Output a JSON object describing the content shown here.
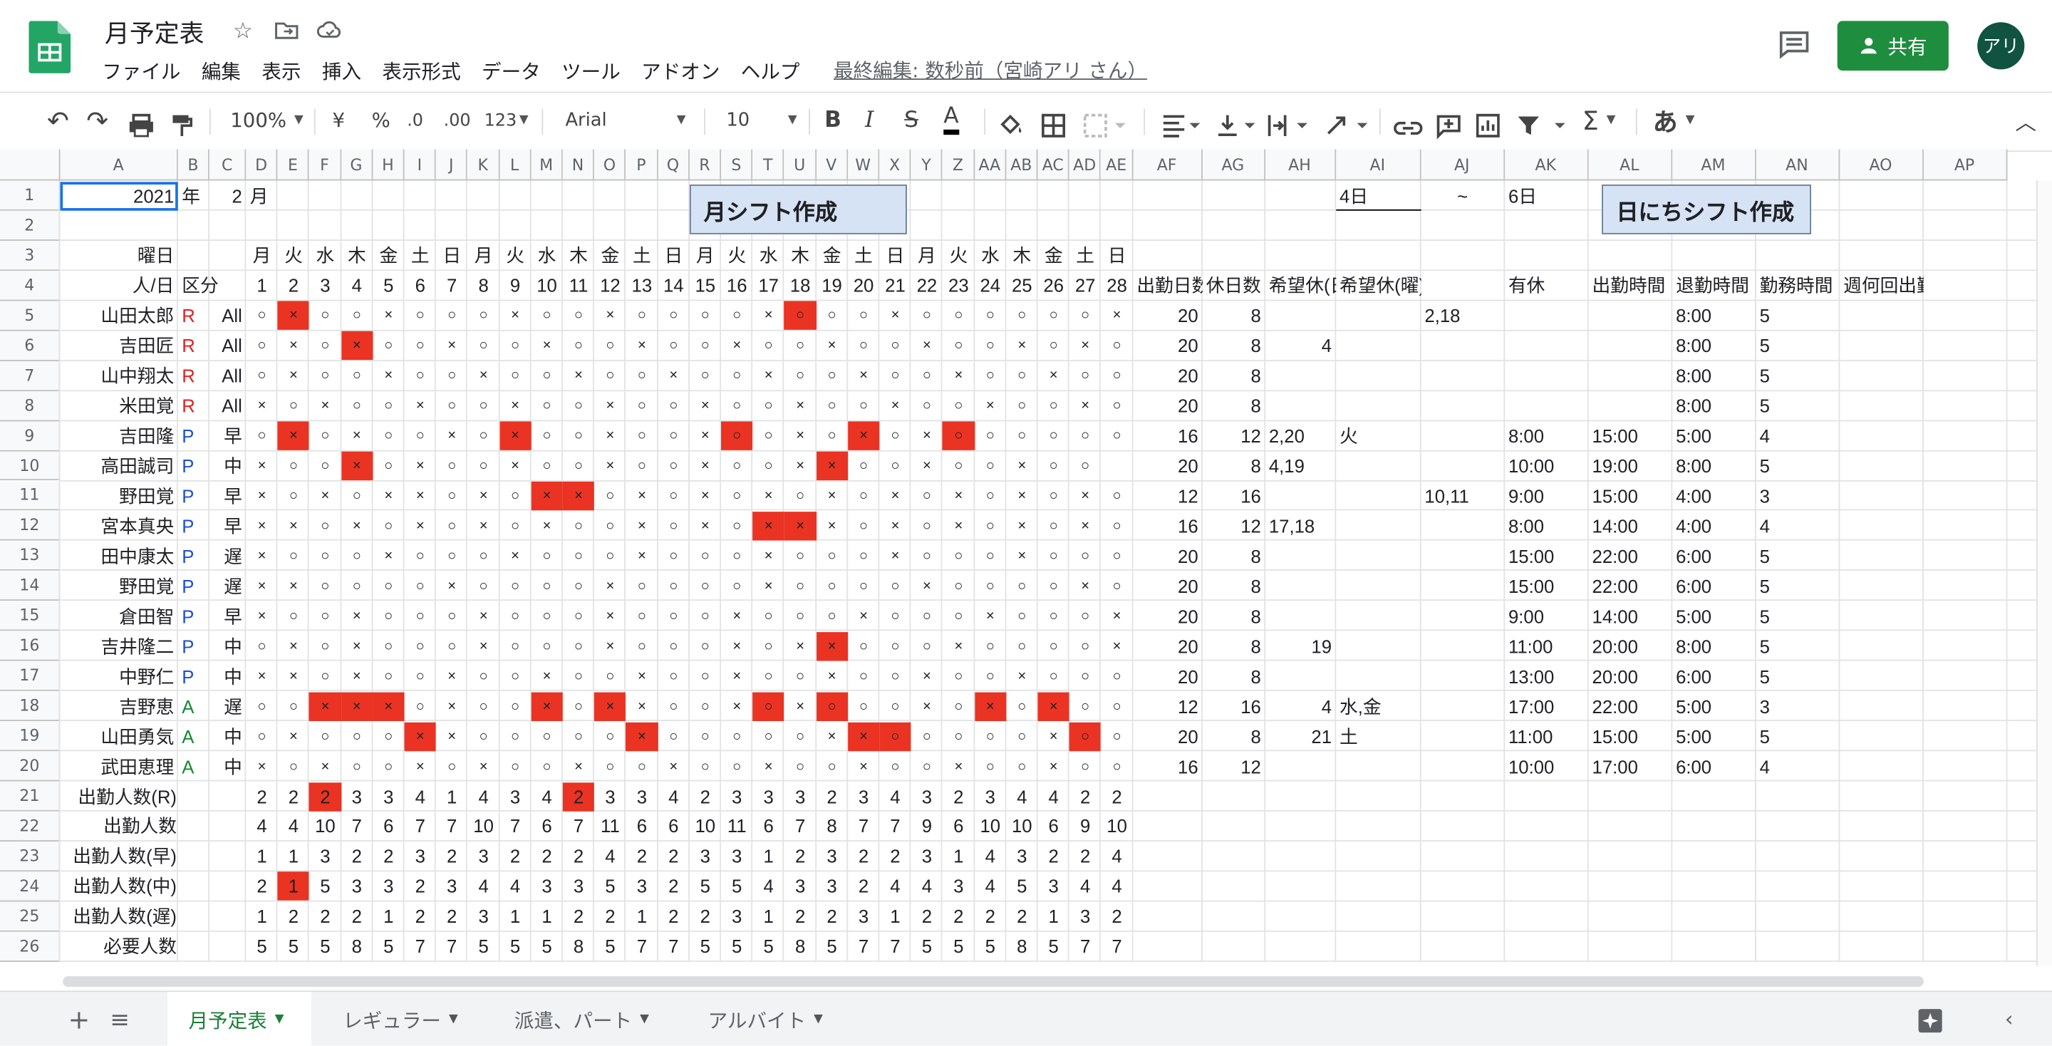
{
  "doc": {
    "title": "月予定表",
    "last_edit": "最終編集: 数秒前（宮崎アリ さん）"
  },
  "menu": [
    "ファイル",
    "編集",
    "表示",
    "挿入",
    "表示形式",
    "データ",
    "ツール",
    "アドオン",
    "ヘルプ"
  ],
  "share_label": "共有",
  "avatar_label": "アリ",
  "toolbar": {
    "zoom": "100%",
    "currency": "¥",
    "percent": "%",
    "dec_decrease": ".0",
    "dec_increase": ".00",
    "format": "123",
    "font": "Arial",
    "size": "10",
    "bold": "B",
    "italic": "I",
    "strike": "S",
    "textcolor": "A",
    "ime": "あ"
  },
  "columns": [
    "A",
    "B",
    "C",
    "D",
    "E",
    "F",
    "G",
    "H",
    "I",
    "J",
    "K",
    "L",
    "M",
    "N",
    "O",
    "P",
    "Q",
    "R",
    "S",
    "T",
    "U",
    "V",
    "W",
    "X",
    "Y",
    "Z",
    "AA",
    "AB",
    "AC",
    "AD",
    "AE",
    "AF",
    "AG",
    "AH",
    "AI",
    "AJ",
    "AK",
    "AL",
    "AM",
    "AN",
    "AO",
    "AP"
  ],
  "rows": [
    "1",
    "2",
    "3",
    "4",
    "5",
    "6",
    "7",
    "8",
    "9",
    "10",
    "11",
    "12",
    "13",
    "14",
    "15",
    "16",
    "17",
    "18",
    "19",
    "20",
    "21",
    "22",
    "23",
    "24",
    "25",
    "26"
  ],
  "buttons": {
    "month": "月シフト作成",
    "day": "日にちシフト作成"
  },
  "row1": {
    "year": "2021",
    "year_unit": "年",
    "month": "2",
    "month_unit": "月",
    "from": "4日",
    "tilde": "~",
    "to": "6日"
  },
  "row3": {
    "label": "曜日",
    "weekdays": [
      "月",
      "火",
      "水",
      "木",
      "金",
      "土",
      "日",
      "月",
      "火",
      "水",
      "木",
      "金",
      "土",
      "日",
      "月",
      "火",
      "水",
      "木",
      "金",
      "土",
      "日",
      "月",
      "火",
      "水",
      "木",
      "金",
      "土",
      "日"
    ]
  },
  "row4": {
    "label": "人/日",
    "kubun": "区分",
    "days": [
      "1",
      "2",
      "3",
      "4",
      "5",
      "6",
      "7",
      "8",
      "9",
      "10",
      "11",
      "12",
      "13",
      "14",
      "15",
      "16",
      "17",
      "18",
      "19",
      "20",
      "21",
      "22",
      "23",
      "24",
      "25",
      "26",
      "27",
      "28"
    ],
    "headers": [
      "出勤日数",
      "休日数",
      "希望休(日)",
      "希望休(曜)",
      "有休",
      "出勤時間",
      "退勤時間",
      "勤務時間",
      "週何回出勤"
    ]
  },
  "staff": [
    {
      "name": "山田太郎",
      "type": "R",
      "shift": "All",
      "days": "○×○○×○○○×○○×○○○○×○○○×○○○○○○×",
      "work": "20",
      "off": "8",
      "wish_day": "",
      "wish_dow": "",
      "paid": "2,18",
      "start": "",
      "end": "",
      "hours": "8:00",
      "weekly": "5"
    },
    {
      "name": "吉田匠",
      "type": "R",
      "shift": "All",
      "days": "○×○×○○×○○×○○×○○×○○×○○×○○×○×○",
      "work": "20",
      "off": "8",
      "wish_day": "4",
      "wish_dow": "",
      "paid": "",
      "start": "",
      "end": "",
      "hours": "8:00",
      "weekly": "5"
    },
    {
      "name": "山中翔太",
      "type": "R",
      "shift": "All",
      "days": "○×○○×○○×○○×○○×○○×○○×○○×○○×○○",
      "work": "20",
      "off": "8",
      "wish_day": "",
      "wish_dow": "",
      "paid": "",
      "start": "",
      "end": "",
      "hours": "8:00",
      "weekly": "5"
    },
    {
      "name": "米田覚",
      "type": "R",
      "shift": "All",
      "days": "×○×○○×○○×○○×○○×○○×○○×○○×○○×○",
      "work": "20",
      "off": "8",
      "wish_day": "",
      "wish_dow": "",
      "paid": "",
      "start": "",
      "end": "",
      "hours": "8:00",
      "weekly": "5"
    },
    {
      "name": "吉田隆",
      "type": "P",
      "shift": "早",
      "days": "○×○×○○×○×○○×○○×○○×○×○×○○○○○○",
      "work": "16",
      "off": "12",
      "wish_day": "2,20",
      "wish_dow": "火",
      "paid": "",
      "start": "8:00",
      "end": "15:00",
      "hours": "5:00",
      "weekly": "4"
    },
    {
      "name": "高田誠司",
      "type": "P",
      "shift": "中",
      "days": "×○○×○×○○×○○×○○×○○××○○×○○×○○",
      "work": "20",
      "off": "8",
      "wish_day": "4,19",
      "wish_dow": "",
      "paid": "",
      "start": "10:00",
      "end": "19:00",
      "hours": "8:00",
      "weekly": "5"
    },
    {
      "name": "野田覚",
      "type": "P",
      "shift": "早",
      "days": "×○×○××○×○××○×○×○×○×○×○×○×○×○",
      "work": "12",
      "off": "16",
      "wish_day": "",
      "wish_dow": "",
      "paid": "10,11",
      "start": "9:00",
      "end": "15:00",
      "hours": "4:00",
      "weekly": "3"
    },
    {
      "name": "宮本真央",
      "type": "P",
      "shift": "早",
      "days": "××○×○×○×○×○○×○×○×××○×○×○×○×○",
      "work": "16",
      "off": "12",
      "wish_day": "17,18",
      "wish_dow": "",
      "paid": "",
      "start": "8:00",
      "end": "14:00",
      "hours": "4:00",
      "weekly": "4"
    },
    {
      "name": "田中康太",
      "type": "P",
      "shift": "遅",
      "days": "×○○○×○○○×○○○×○○○×○○○×○○○×○○○",
      "work": "20",
      "off": "8",
      "wish_day": "",
      "wish_dow": "",
      "paid": "",
      "start": "15:00",
      "end": "22:00",
      "hours": "6:00",
      "weekly": "5"
    },
    {
      "name": "野田覚",
      "type": "P",
      "shift": "遅",
      "days": "××○○○○×○○○○×○○○○×○○○○×○○○○×○",
      "work": "20",
      "off": "8",
      "wish_day": "",
      "wish_dow": "",
      "paid": "",
      "start": "15:00",
      "end": "22:00",
      "hours": "6:00",
      "weekly": "5"
    },
    {
      "name": "倉田智",
      "type": "P",
      "shift": "早",
      "days": "×○○×○○○×○○○×○○○×○○○×○○○×○○○×",
      "work": "20",
      "off": "8",
      "wish_day": "",
      "wish_dow": "",
      "paid": "",
      "start": "9:00",
      "end": "14:00",
      "hours": "5:00",
      "weekly": "5"
    },
    {
      "name": "吉井隆二",
      "type": "P",
      "shift": "中",
      "days": "○×○×○○○×○○○×○○○×○××○○○×○○○○×",
      "work": "20",
      "off": "8",
      "wish_day": "19",
      "wish_dow": "",
      "paid": "",
      "start": "11:00",
      "end": "20:00",
      "hours": "8:00",
      "weekly": "5"
    },
    {
      "name": "中野仁",
      "type": "P",
      "shift": "中",
      "days": "××○×○○×○○×○○×○○×○○×○○×○○×○○○",
      "work": "20",
      "off": "8",
      "wish_day": "",
      "wish_dow": "",
      "paid": "",
      "start": "13:00",
      "end": "20:00",
      "hours": "6:00",
      "weekly": "5"
    },
    {
      "name": "吉野恵",
      "type": "A",
      "shift": "遅",
      "days": "○○×××○×○○×○××○○×○×○○○×○×○×○○",
      "work": "12",
      "off": "16",
      "wish_day": "4",
      "wish_dow": "水,金",
      "paid": "",
      "start": "17:00",
      "end": "22:00",
      "hours": "5:00",
      "weekly": "3"
    },
    {
      "name": "山田勇気",
      "type": "A",
      "shift": "中",
      "days": "○×○○○××○○○○○×○○○○○××○○○○○×○○",
      "work": "20",
      "off": "8",
      "wish_day": "21",
      "wish_dow": "土",
      "paid": "",
      "start": "11:00",
      "end": "15:00",
      "hours": "5:00",
      "weekly": "5"
    },
    {
      "name": "武田恵理",
      "type": "A",
      "shift": "中",
      "days": "×○×○○×○×○○×○○×○○×○○×○○×○○×○○",
      "work": "16",
      "off": "12",
      "wish_day": "",
      "wish_dow": "",
      "paid": "",
      "start": "10:00",
      "end": "17:00",
      "hours": "6:00",
      "weekly": "4"
    }
  ],
  "red_cells": [
    [
      0,
      2
    ],
    [
      0,
      18
    ],
    [
      1,
      4
    ],
    [
      4,
      2
    ],
    [
      4,
      9
    ],
    [
      4,
      16
    ],
    [
      4,
      20
    ],
    [
      4,
      23
    ],
    [
      5,
      4
    ],
    [
      5,
      19
    ],
    [
      6,
      10
    ],
    [
      6,
      11
    ],
    [
      7,
      17
    ],
    [
      7,
      18
    ],
    [
      11,
      19
    ],
    [
      13,
      3
    ],
    [
      13,
      4
    ],
    [
      13,
      5
    ],
    [
      13,
      10
    ],
    [
      13,
      12
    ],
    [
      13,
      17
    ],
    [
      13,
      19
    ],
    [
      13,
      24
    ],
    [
      13,
      26
    ],
    [
      14,
      6
    ],
    [
      14,
      13
    ],
    [
      14,
      20
    ],
    [
      14,
      21
    ],
    [
      14,
      27
    ]
  ],
  "summary": [
    {
      "label": "出勤人数(R)",
      "values": [
        "2",
        "2",
        "2",
        "3",
        "3",
        "4",
        "1",
        "4",
        "3",
        "4",
        "2",
        "3",
        "3",
        "4",
        "2",
        "3",
        "3",
        "3",
        "2",
        "3",
        "4",
        "3",
        "2",
        "3",
        "4",
        "4",
        "2",
        "2"
      ],
      "red": [
        3,
        11
      ]
    },
    {
      "label": "出勤人数",
      "values": [
        "4",
        "4",
        "10",
        "7",
        "6",
        "7",
        "7",
        "10",
        "7",
        "6",
        "7",
        "11",
        "6",
        "6",
        "10",
        "11",
        "6",
        "7",
        "8",
        "7",
        "7",
        "9",
        "6",
        "10",
        "10",
        "6",
        "9",
        "10"
      ],
      "red": []
    },
    {
      "label": "出勤人数(早)",
      "values": [
        "1",
        "1",
        "3",
        "2",
        "2",
        "3",
        "2",
        "3",
        "2",
        "2",
        "2",
        "4",
        "2",
        "2",
        "3",
        "3",
        "1",
        "2",
        "3",
        "2",
        "2",
        "3",
        "1",
        "4",
        "3",
        "2",
        "2",
        "4"
      ],
      "red": []
    },
    {
      "label": "出勤人数(中)",
      "values": [
        "2",
        "1",
        "5",
        "3",
        "3",
        "2",
        "3",
        "4",
        "4",
        "3",
        "3",
        "5",
        "3",
        "2",
        "5",
        "5",
        "4",
        "3",
        "3",
        "2",
        "4",
        "4",
        "3",
        "4",
        "5",
        "3",
        "4",
        "4"
      ],
      "red": [
        2
      ]
    },
    {
      "label": "出勤人数(遅)",
      "values": [
        "1",
        "2",
        "2",
        "2",
        "1",
        "2",
        "2",
        "3",
        "1",
        "1",
        "2",
        "2",
        "1",
        "2",
        "2",
        "3",
        "1",
        "2",
        "2",
        "3",
        "1",
        "2",
        "2",
        "2",
        "2",
        "1",
        "3",
        "2"
      ],
      "red": []
    },
    {
      "label": "必要人数",
      "values": [
        "5",
        "5",
        "5",
        "8",
        "5",
        "7",
        "7",
        "5",
        "5",
        "5",
        "8",
        "5",
        "7",
        "7",
        "5",
        "5",
        "5",
        "8",
        "5",
        "7",
        "7",
        "5",
        "5",
        "5",
        "8",
        "5",
        "7",
        "7"
      ],
      "red": []
    }
  ],
  "sheets": [
    "月予定表",
    "レギュラー",
    "派遣、パート",
    "アルバイト"
  ],
  "colors": {
    "accent_green": "#1e8e3e",
    "red_fill": "#ea3323",
    "button_fill": "#d6e3f5",
    "type_R": "#e02020",
    "type_P": "#1a4fd0",
    "type_A": "#138a33"
  }
}
